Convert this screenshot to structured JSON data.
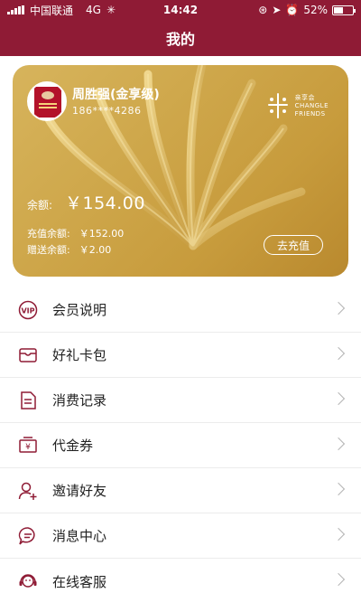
{
  "status": {
    "carrier": "中国联通",
    "network": "4G",
    "time": "14:42",
    "battery": "52%",
    "battery_level": 0.52
  },
  "nav": {
    "title": "我的"
  },
  "card": {
    "name": "周胜强(金享级)",
    "phone": "186****4286",
    "brand_name": "亲享会",
    "brand_en_1": "CHANGLE",
    "brand_en_2": "FRIENDS",
    "balance_label": "余额:",
    "balance_value": "￥154.00",
    "recharge_label": "充值余额:",
    "recharge_value": "￥152.00",
    "gift_label": "赠送余额:",
    "gift_value": "￥2.00",
    "topup_label": "去充值"
  },
  "menu": [
    {
      "label": "会员说明",
      "icon": "vip-icon"
    },
    {
      "label": "好礼卡包",
      "icon": "wallet-icon"
    },
    {
      "label": "消费记录",
      "icon": "document-icon"
    },
    {
      "label": "代金券",
      "icon": "coupon-icon"
    },
    {
      "label": "邀请好友",
      "icon": "add-user-icon"
    },
    {
      "label": "消息中心",
      "icon": "message-icon"
    },
    {
      "label": "在线客服",
      "icon": "service-icon"
    }
  ],
  "colors": {
    "brand": "#8f1b35",
    "card_gold": "#cfa84c",
    "icon": "#8f1b35"
  }
}
